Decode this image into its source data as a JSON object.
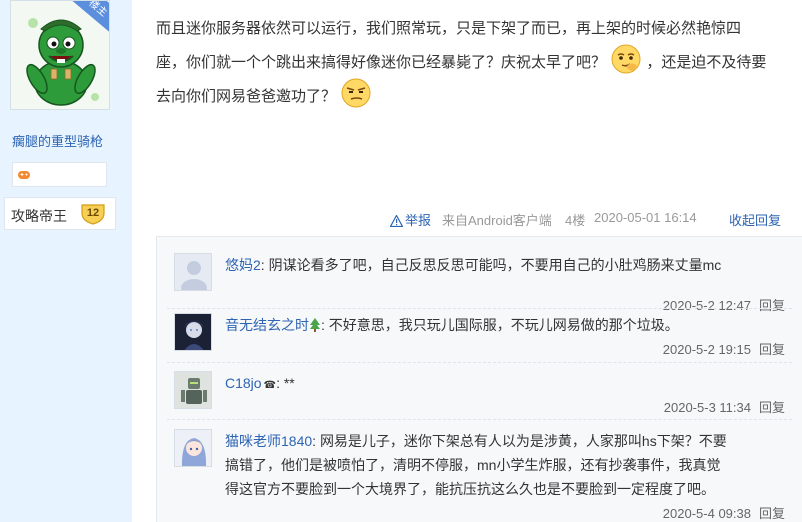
{
  "author": {
    "ribbon": "楼主",
    "name": "瘸腿的重型骑枪",
    "title": "攻略帝王",
    "level": "12"
  },
  "post": {
    "line1": "而且迷你服务器依然可以运行，我们照常玩，只是下架了而已，再上架的时候必然艳惊四",
    "line2a": "座，你们就一个个跳出来搞得好像迷你已经暴毙了？庆祝太早了吧？",
    "line2b": "，还是迫不及待要",
    "line3": "去向你们网易爸爸邀功了？"
  },
  "meta": {
    "report": "举报",
    "client": "来自Android客户端",
    "floor": "4楼",
    "time": "2020-05-01 16:14",
    "collapse": "收起回复"
  },
  "replies": [
    {
      "name": "悠妈2",
      "text": "阴谋论看多了吧，自己反思反思可能吗，不要用自己的小肚鸡肠来丈量mc",
      "time": "2020-5-2 12:47",
      "reply": "回复"
    },
    {
      "name": "音无结玄之时",
      "text": "不好意思，我只玩儿国际服，不玩儿网易做的那个垃圾。",
      "time": "2020-5-2 19:15",
      "reply": "回复"
    },
    {
      "name": "C18jo",
      "text": "**",
      "time": "2020-5-3 11:34",
      "reply": "回复"
    },
    {
      "name": "猫咪老师1840",
      "text1": "网易是儿子，迷你下架总有人以为是涉黄，人家那叫hs下架？不要",
      "text2": "搞错了，他们是被喷怕了，清明不停服，mn小学生炸服，还有抄袭事件，我真觉",
      "text3": "得这官方不要脸到一个大境界了，能抗压抗这么久也是不要脸到一定程度了吧。",
      "time": "2020-5-4 09:38",
      "reply": "回复"
    }
  ],
  "colors": {
    "link": "#2d64b3",
    "side_bg": "#e7f3fe",
    "reply_bg": "#f7f8fa"
  }
}
